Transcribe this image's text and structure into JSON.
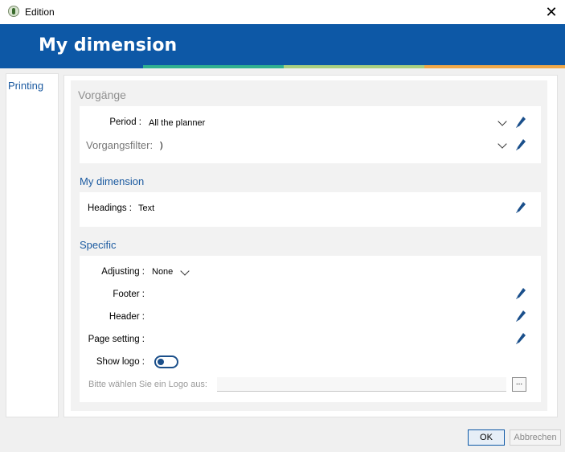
{
  "window": {
    "title": "Edition",
    "close_glyph": "✕"
  },
  "banner": {
    "title": "My dimension",
    "stripe_colors": [
      "#0d58a6",
      "#30b090",
      "#a8cf80",
      "#f0a848"
    ]
  },
  "sidebar": {
    "items": [
      {
        "label": "Printing"
      }
    ]
  },
  "sections": {
    "vorgaenge": {
      "title": "Vorgänge",
      "period_label": "Period :",
      "period_value": "All the planner",
      "filter_label": "Vorgangsfilter:",
      "filter_value": ")"
    },
    "dimension": {
      "title": "My dimension",
      "headings_label": "Headings :",
      "headings_value": "Text"
    },
    "specific": {
      "title": "Specific",
      "adjusting_label": "Adjusting :",
      "adjusting_value": "None",
      "footer_label": "Footer :",
      "header_label": "Header :",
      "page_setting_label": "Page setting :",
      "show_logo_label": "Show logo :",
      "show_logo_on": false,
      "logo_prompt": "Bitte wählen Sie ein Logo aus:",
      "browse_label": "..."
    }
  },
  "footer": {
    "ok_label": "OK",
    "cancel_label": "Abbrechen"
  },
  "colors": {
    "accent": "#0d58a6",
    "label_blue": "#1b5aa0",
    "icon_blue": "#1a4f8b"
  },
  "icons": [
    "app-icon",
    "close-icon",
    "pencil-icon",
    "chevron-down-icon"
  ]
}
